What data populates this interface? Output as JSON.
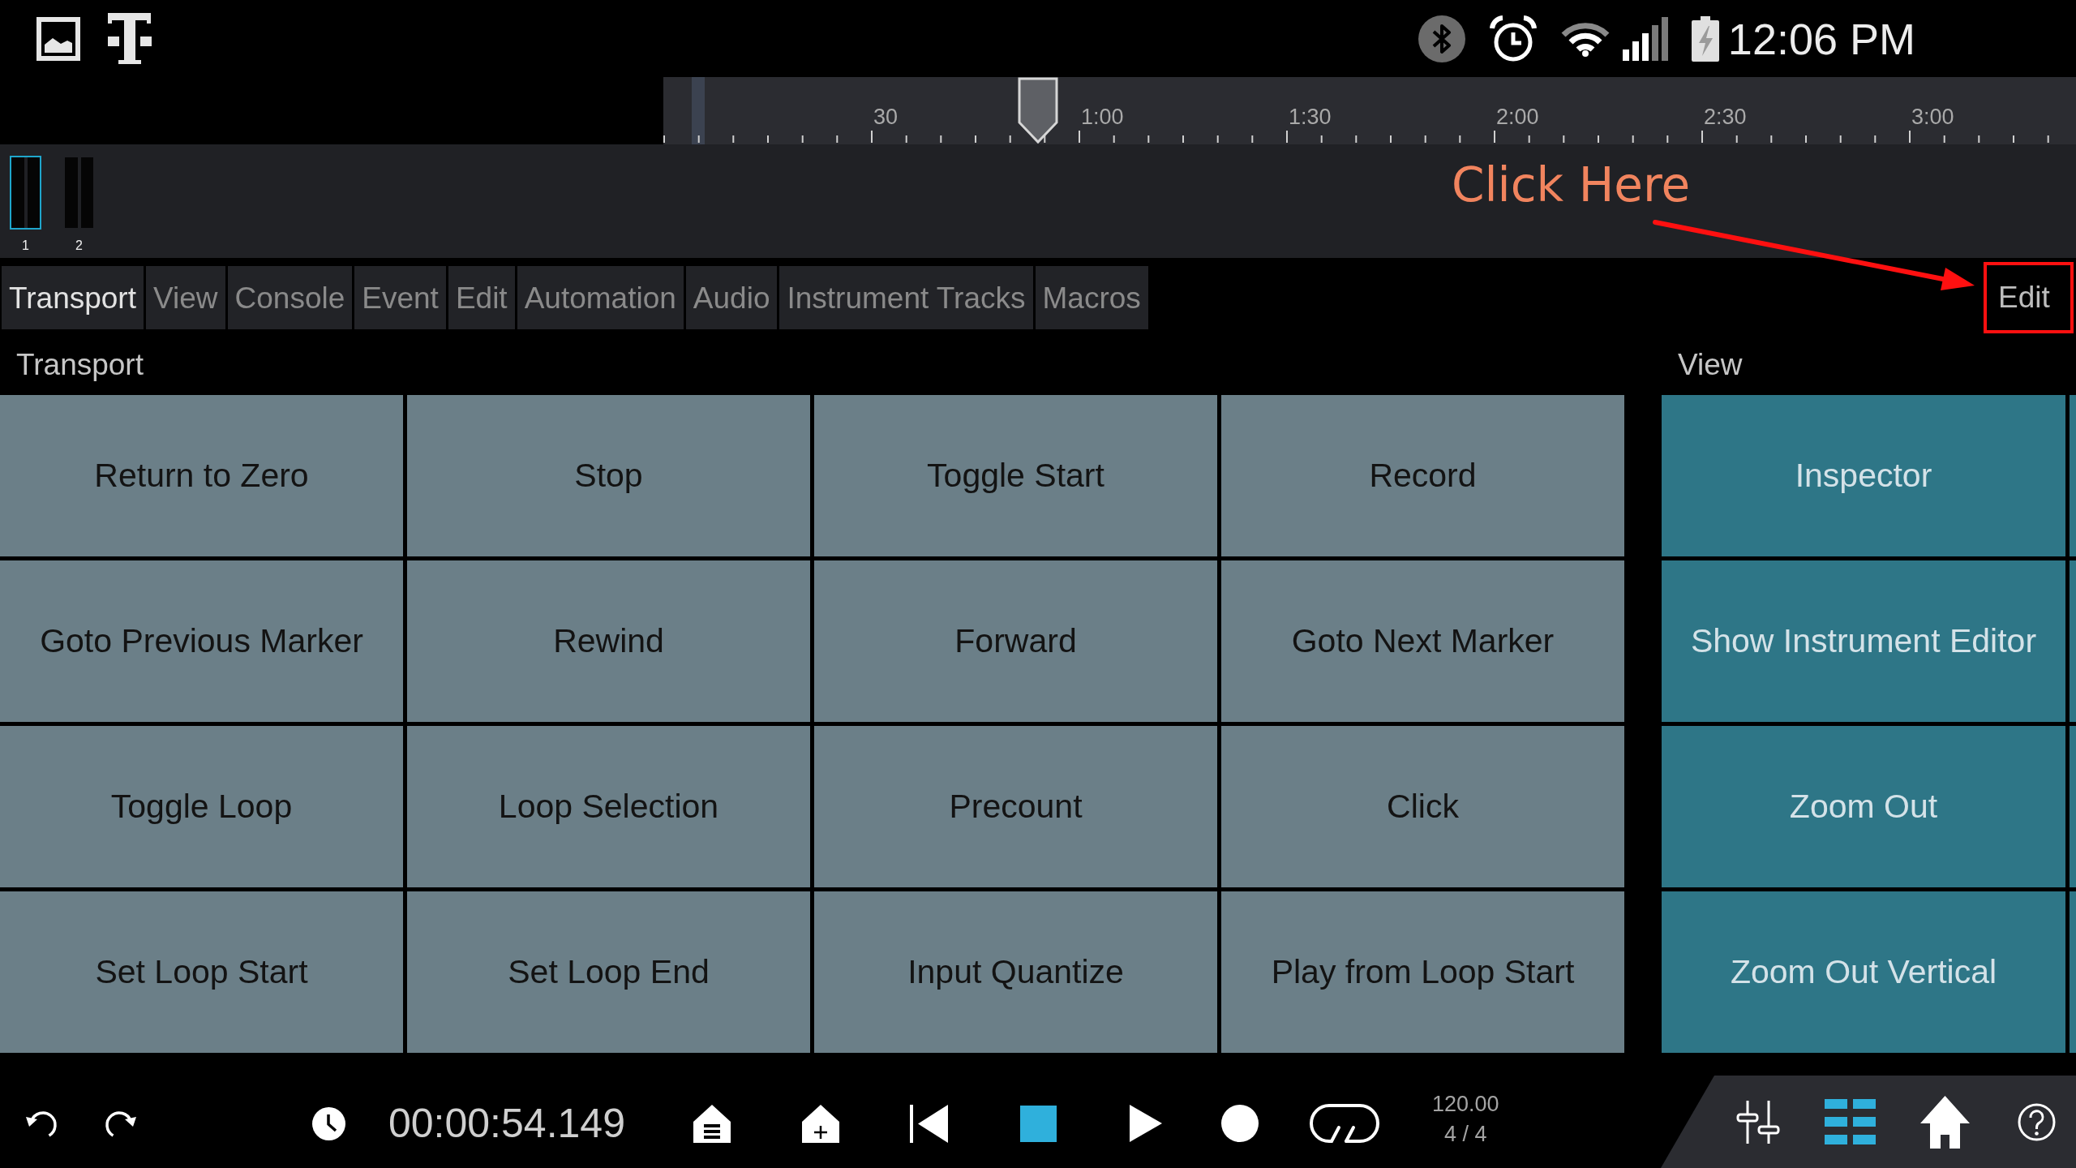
{
  "status_bar": {
    "time": "12:06 PM"
  },
  "timeline": {
    "labels": [
      "30",
      "1:00",
      "1:30",
      "2:00",
      "2:30",
      "3:00"
    ],
    "playhead": {
      "level": 0.2652
    }
  },
  "tracks": [
    {
      "label": "1",
      "selected": true
    },
    {
      "label": "2",
      "selected": false
    }
  ],
  "annotation": {
    "text": "Click Here"
  },
  "tabs": [
    {
      "label": "Transport",
      "selected": true
    },
    {
      "label": "View",
      "selected": false
    },
    {
      "label": "Console",
      "selected": false
    },
    {
      "label": "Event",
      "selected": false
    },
    {
      "label": "Edit",
      "selected": false
    },
    {
      "label": "Automation",
      "selected": false
    },
    {
      "label": "Audio",
      "selected": false
    },
    {
      "label": "Instrument Tracks",
      "selected": false
    },
    {
      "label": "Macros",
      "selected": false
    }
  ],
  "edit_button": {
    "label": "Edit"
  },
  "sections": [
    {
      "title": "Transport",
      "kind": "transport",
      "buttons": [
        "Return to Zero",
        "Stop",
        "Toggle Start",
        "Record",
        "Goto Previous Marker",
        "Rewind",
        "Forward",
        "Goto Next Marker",
        "Toggle Loop",
        "Loop Selection",
        "Precount",
        "Click",
        "Set Loop Start",
        "Set Loop End",
        "Input Quantize",
        "Play from Loop Start"
      ]
    },
    {
      "title": "View",
      "kind": "view",
      "buttons": [
        "Inspector",
        "Show Instrument Editor",
        "Zoom Out",
        "Zoom Out Vertical"
      ]
    }
  ],
  "bottom_bar": {
    "time": "00:00:54.149",
    "tempo": "120.00",
    "signature": "4 / 4",
    "transport_controls": [
      {
        "kind": "skip-to-start",
        "on": false
      },
      {
        "kind": "stop",
        "on": true
      },
      {
        "kind": "play",
        "on": false
      },
      {
        "kind": "record",
        "on": false
      },
      {
        "kind": "loop",
        "on": false
      }
    ],
    "nav": [
      {
        "kind": "mixer",
        "selected": false
      },
      {
        "kind": "list",
        "selected": true
      },
      {
        "kind": "home",
        "selected": false
      },
      {
        "kind": "help",
        "selected": false
      }
    ]
  }
}
